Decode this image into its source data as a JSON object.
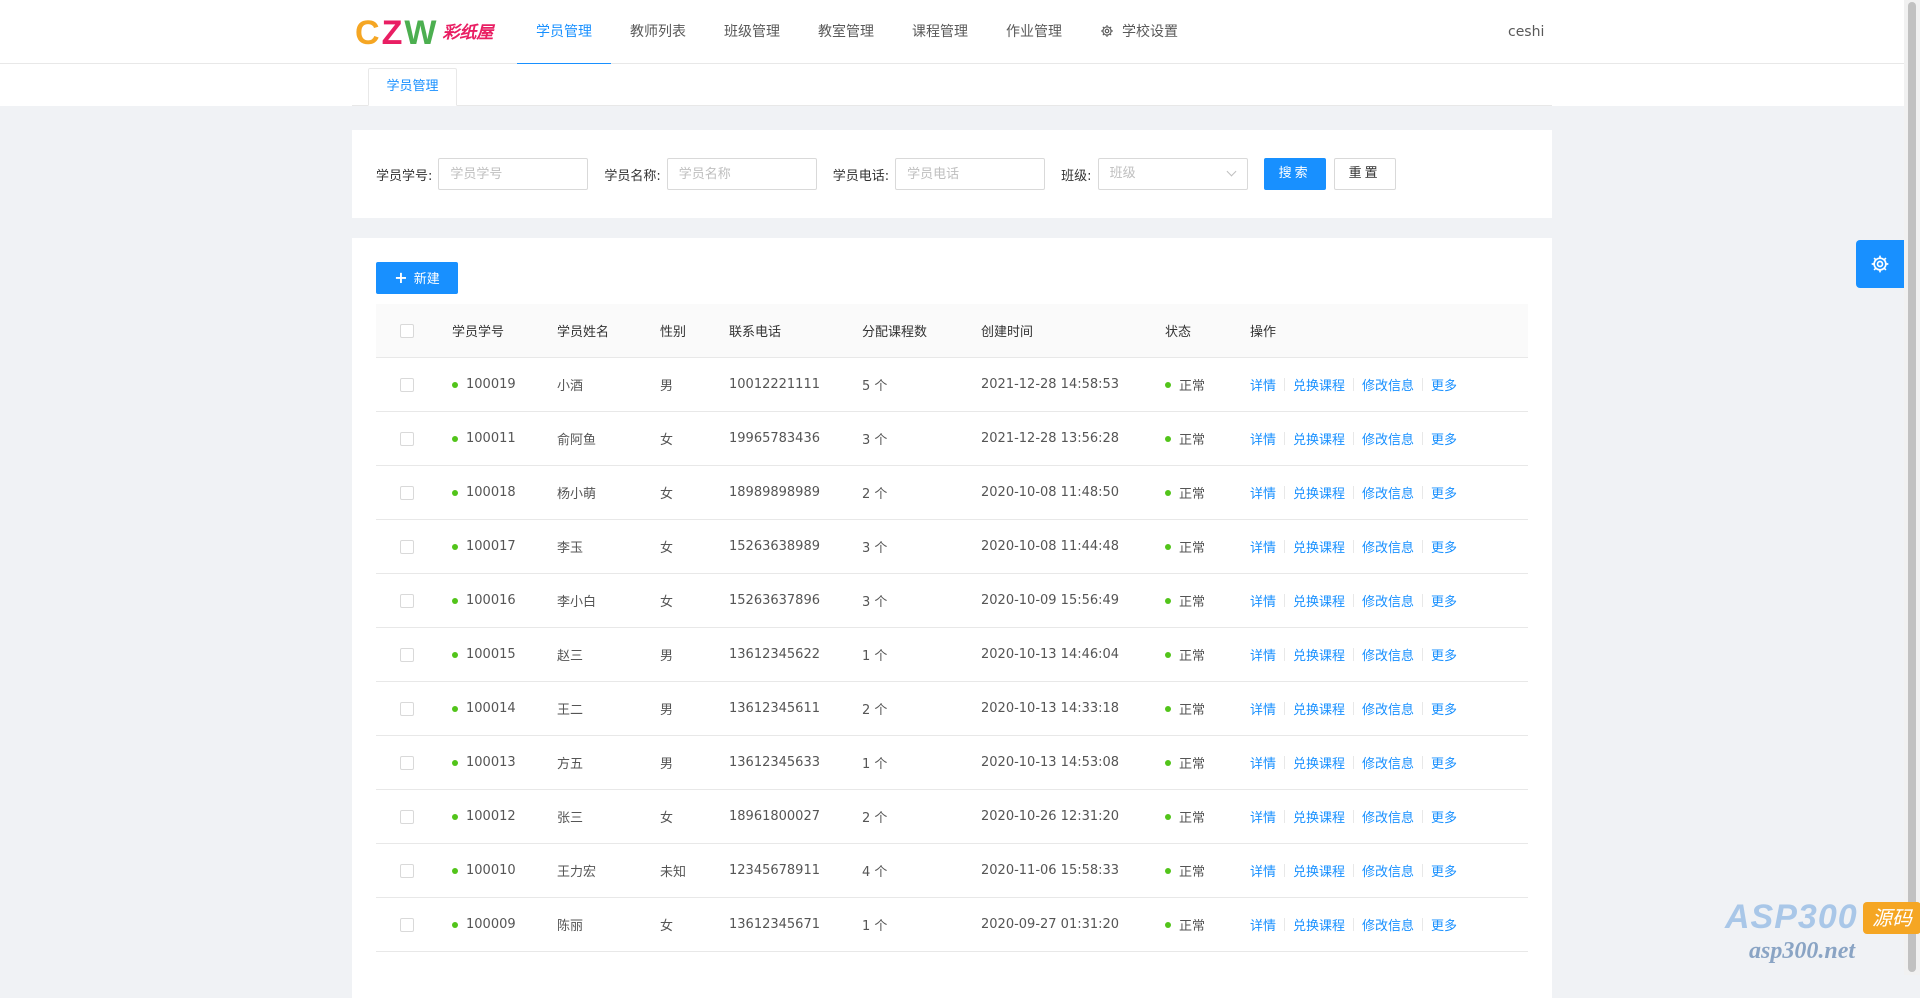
{
  "header": {
    "logo_text_c": "C",
    "logo_text_z": "Z",
    "logo_text_w": "W",
    "logo_text_cn": "彩纸屋",
    "nav": [
      {
        "label": "学员管理",
        "active": true
      },
      {
        "label": "教师列表",
        "active": false
      },
      {
        "label": "班级管理",
        "active": false
      },
      {
        "label": "教室管理",
        "active": false
      },
      {
        "label": "课程管理",
        "active": false
      },
      {
        "label": "作业管理",
        "active": false
      },
      {
        "label": "学校设置",
        "active": false,
        "icon": "gear-icon"
      }
    ],
    "user": "ceshi"
  },
  "tabs": [
    {
      "label": "学员管理"
    }
  ],
  "search": {
    "student_id_label": "学员学号:",
    "student_id_placeholder": "学员学号",
    "student_name_label": "学员名称:",
    "student_name_placeholder": "学员名称",
    "student_phone_label": "学员电话:",
    "student_phone_placeholder": "学员电话",
    "class_label": "班级:",
    "class_placeholder": "班级",
    "search_button": "搜索",
    "reset_button": "重置"
  },
  "table": {
    "new_button": "新建",
    "columns": [
      "学员学号",
      "学员姓名",
      "性别",
      "联系电话",
      "分配课程数",
      "创建时间",
      "状态",
      "操作"
    ],
    "actions": [
      "详情",
      "兑换课程",
      "修改信息",
      "更多"
    ],
    "rows": [
      {
        "id": "100019",
        "name": "小酒",
        "gender": "男",
        "phone": "10012221111",
        "courses": "5 个",
        "created": "2021-12-28 14:58:53",
        "status": "正常"
      },
      {
        "id": "100011",
        "name": "俞阿鱼",
        "gender": "女",
        "phone": "19965783436",
        "courses": "3 个",
        "created": "2021-12-28 13:56:28",
        "status": "正常"
      },
      {
        "id": "100018",
        "name": "杨小萌",
        "gender": "女",
        "phone": "18989898989",
        "courses": "2 个",
        "created": "2020-10-08 11:48:50",
        "status": "正常"
      },
      {
        "id": "100017",
        "name": "李玉",
        "gender": "女",
        "phone": "15263638989",
        "courses": "3 个",
        "created": "2020-10-08 11:44:48",
        "status": "正常"
      },
      {
        "id": "100016",
        "name": "李小白",
        "gender": "女",
        "phone": "15263637896",
        "courses": "3 个",
        "created": "2020-10-09 15:56:49",
        "status": "正常"
      },
      {
        "id": "100015",
        "name": "赵三",
        "gender": "男",
        "phone": "13612345622",
        "courses": "1 个",
        "created": "2020-10-13 14:46:04",
        "status": "正常"
      },
      {
        "id": "100014",
        "name": "王二",
        "gender": "男",
        "phone": "13612345611",
        "courses": "2 个",
        "created": "2020-10-13 14:33:18",
        "status": "正常"
      },
      {
        "id": "100013",
        "name": "方五",
        "gender": "男",
        "phone": "13612345633",
        "courses": "1 个",
        "created": "2020-10-13 14:53:08",
        "status": "正常"
      },
      {
        "id": "100012",
        "name": "张三",
        "gender": "女",
        "phone": "18961800027",
        "courses": "2 个",
        "created": "2020-10-26 12:31:20",
        "status": "正常"
      },
      {
        "id": "100010",
        "name": "王力宏",
        "gender": "未知",
        "phone": "12345678911",
        "courses": "4 个",
        "created": "2020-11-06 15:58:33",
        "status": "正常"
      },
      {
        "id": "100009",
        "name": "陈丽",
        "gender": "女",
        "phone": "13612345671",
        "courses": "1 个",
        "created": "2020-09-27 01:31:20",
        "status": "正常"
      }
    ]
  },
  "watermark": {
    "brand": "ASP300",
    "tag": "源码",
    "site": "asp300.net"
  },
  "colors": {
    "primary": "#1890ff",
    "status_ok": "#52c41a",
    "background": "#f0f2f5"
  }
}
